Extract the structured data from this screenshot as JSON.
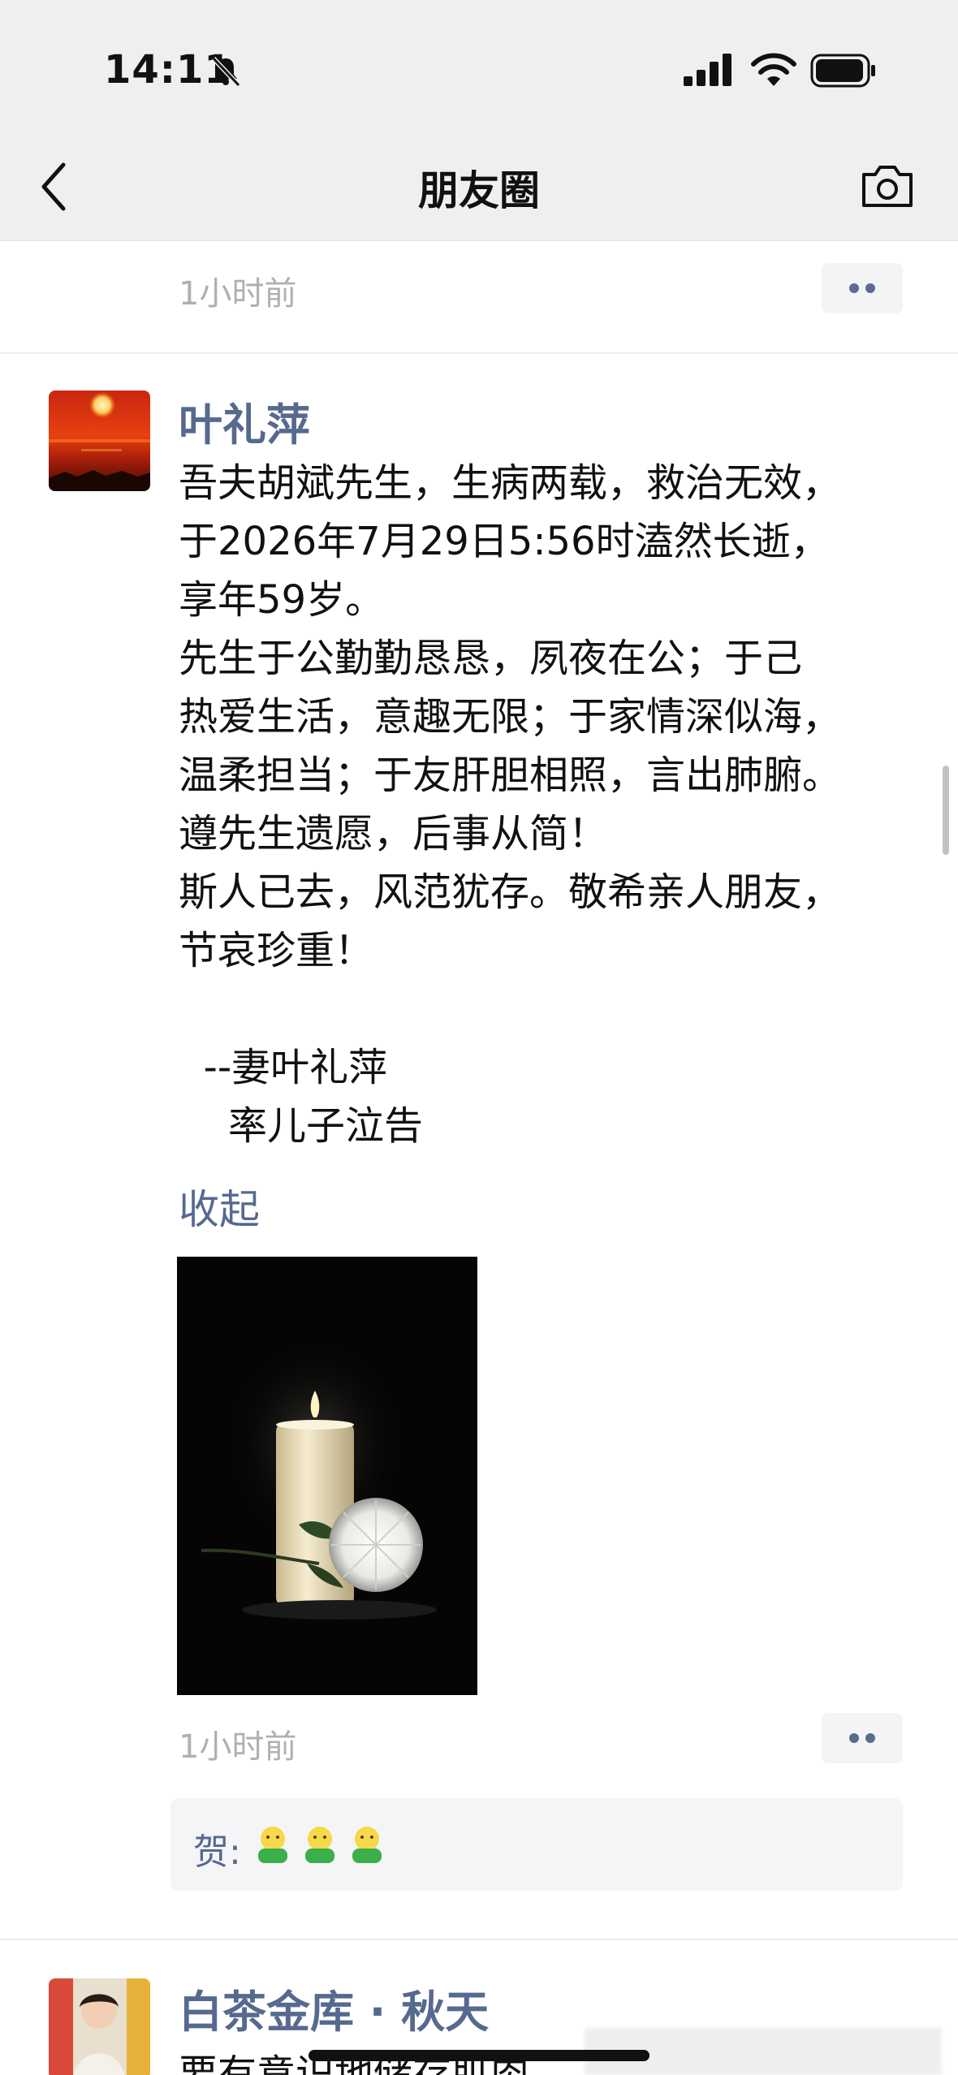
{
  "status_bar": {
    "time": "14:11"
  },
  "header": {
    "title": "朋友圈"
  },
  "prev_post": {
    "time": "1小时前"
  },
  "post": {
    "author": "叶礼萍",
    "body_lines": [
      "吾夫胡斌先生，生病两载，救治无效，",
      "于2026年7月29日5:56时溘然长逝，",
      "享年59岁。",
      "先生于公勤勤恳恳，夙夜在公；于己",
      "热爱生活，意趣无限；于家情深似海，",
      "温柔担当；于友肝胆相照，言出肺腑。",
      "遵先生遗愿，后事从简！",
      "斯人已去，风范犹存。敬希亲人朋友，",
      "节哀珍重！",
      "",
      "  --妻叶礼萍",
      "    率儿子泣告"
    ],
    "collapse_label": "收起",
    "time": "1小时前",
    "comment": {
      "label": "贺:"
    }
  },
  "next_post": {
    "author": "白茶金库 · 秋天",
    "snippet": "要有意识地储存肌肉，"
  },
  "icons": {
    "back": "back-chevron-icon",
    "camera": "camera-icon",
    "bell_off": "bell-off-icon",
    "signal": "cellular-signal-icon",
    "wifi": "wifi-icon",
    "battery": "battery-icon",
    "more": "more-dots-icon",
    "emoji": "fist-emoji-icon"
  },
  "colors": {
    "link": "#56698f",
    "header_bg": "#efeff1",
    "meta_text": "#b0b0b4"
  }
}
